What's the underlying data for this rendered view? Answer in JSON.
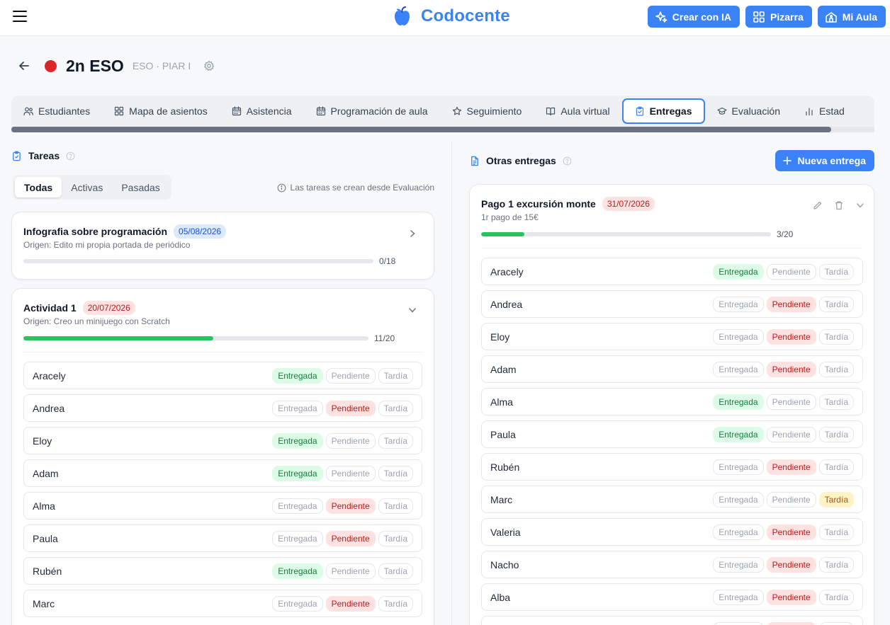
{
  "app": {
    "name": "Codocente"
  },
  "top_actions": [
    {
      "label": "Crear con IA",
      "icon": "sparkles-icon"
    },
    {
      "label": "Pizarra",
      "icon": "grid-icon"
    },
    {
      "label": "Mi Aula",
      "icon": "school-icon"
    }
  ],
  "class": {
    "title": "2n ESO",
    "subtitle": "ESO · PIAR I",
    "dot_color": "#dc2626"
  },
  "tabs": [
    {
      "label": "Estudiantes",
      "icon": "users-icon"
    },
    {
      "label": "Mapa de asientos",
      "icon": "grid-icon"
    },
    {
      "label": "Asistencia",
      "icon": "calendar-icon"
    },
    {
      "label": "Programación de aula",
      "icon": "calendar-icon"
    },
    {
      "label": "Seguimiento",
      "icon": "star-icon"
    },
    {
      "label": "Aula virtual",
      "icon": "book-icon"
    },
    {
      "label": "Entregas",
      "icon": "clipboard-icon",
      "active": true
    },
    {
      "label": "Evaluación",
      "icon": "graduation-cap-icon"
    },
    {
      "label": "Estad",
      "icon": "bar-chart-icon"
    }
  ],
  "status_labels": {
    "entregada": "Entregada",
    "pendiente": "Pendiente",
    "tardia": "Tardía"
  },
  "colors": {
    "accent": "#3b82f6",
    "success": "#22c55e",
    "danger": "#dc2626",
    "warning": "#f59e0b"
  },
  "tareas": {
    "title": "Tareas",
    "filters": [
      "Todas",
      "Activas",
      "Pasadas"
    ],
    "active_filter": "Todas",
    "hint": "Las tareas se crean desde Evaluación",
    "cards": [
      {
        "title": "Infografia sobre programación",
        "date": "05/08/2026",
        "origin": "Origen: Edito mi propia portada de periódico",
        "delivered": 0,
        "total": 18,
        "count": "0/18",
        "expanded": false
      },
      {
        "title": "Actividad 1",
        "date": "20/07/2026",
        "origin": "Origen: Creo un minijuego con Scratch",
        "delivered": 11,
        "total": 20,
        "count": "11/20",
        "expanded": true,
        "students": [
          {
            "name": "Aracely",
            "status": "entregada"
          },
          {
            "name": "Andrea",
            "status": "pendiente"
          },
          {
            "name": "Eloy",
            "status": "entregada"
          },
          {
            "name": "Adam",
            "status": "entregada"
          },
          {
            "name": "Alma",
            "status": "pendiente"
          },
          {
            "name": "Paula",
            "status": "pendiente"
          },
          {
            "name": "Rubén",
            "status": "entregada"
          },
          {
            "name": "Marc",
            "status": "pendiente"
          }
        ]
      }
    ]
  },
  "otras": {
    "title": "Otras entregas",
    "new_button": "Nueva entrega",
    "card": {
      "title": "Pago 1 excursión monte",
      "date": "31/07/2026",
      "description": "1r pago de 15€",
      "delivered": 3,
      "total": 20,
      "count": "3/20",
      "students": [
        {
          "name": "Aracely",
          "status": "entregada"
        },
        {
          "name": "Andrea",
          "status": "pendiente"
        },
        {
          "name": "Eloy",
          "status": "pendiente"
        },
        {
          "name": "Adam",
          "status": "pendiente"
        },
        {
          "name": "Alma",
          "status": "entregada"
        },
        {
          "name": "Paula",
          "status": "entregada"
        },
        {
          "name": "Rubén",
          "status": "pendiente"
        },
        {
          "name": "Marc",
          "status": "tardia"
        },
        {
          "name": "Valeria",
          "status": "pendiente"
        },
        {
          "name": "Nacho",
          "status": "pendiente"
        },
        {
          "name": "Alba",
          "status": "pendiente"
        },
        {
          "name": "",
          "status": "pendiente"
        }
      ]
    }
  }
}
